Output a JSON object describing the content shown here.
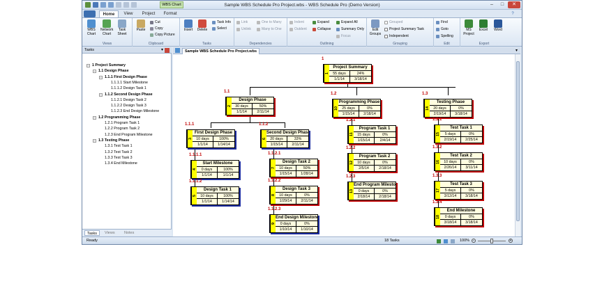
{
  "window": {
    "title": "Sample WBS Schedule Pro Project.wbs - WBS Schedule Pro (Demo Version)",
    "context_tab": "WBS Chart"
  },
  "tabs": [
    "Home",
    "View",
    "Project",
    "Format"
  ],
  "ribbon": {
    "views": {
      "label": "Views",
      "wbs_chart": "WBS\nChart",
      "network_chart": "Network\nChart",
      "task_sheet": "Task\nSheet"
    },
    "clipboard": {
      "label": "Clipboard",
      "paste": "Paste",
      "cut": "Cut",
      "copy": "Copy",
      "copy_picture": "Copy Picture"
    },
    "tasks": {
      "label": "Tasks",
      "insert": "Insert",
      "delete": "Delete",
      "task_info": "Task Info",
      "select": "Select"
    },
    "dependencies": {
      "label": "Dependencies",
      "link": "Link",
      "unlink": "Unlink",
      "one_to_many": "One to Many",
      "many_to_one": "Many to One"
    },
    "outlining": {
      "label": "Outlining",
      "indent": "Indent",
      "outdent": "Outdent",
      "expand": "Expand",
      "collapse": "Collapse",
      "expand_all": "Expand All",
      "summary_only": "Summary Only",
      "focus": "Focus"
    },
    "grouping": {
      "label": "Grouping",
      "edit_groups": "Edit\nGroups",
      "grouped": "Grouped",
      "project_summary_task": "Project Summary Task",
      "independent": "Independent"
    },
    "edit": {
      "label": "Edit",
      "find": "Find",
      "goto": "Goto",
      "spelling": "Spelling"
    },
    "export": {
      "label": "Export",
      "ms_project": "MS\nProject",
      "excel": "Excel",
      "word": "Word"
    }
  },
  "tasks_pane": {
    "title": "Tasks",
    "tree": [
      {
        "label": "1 Project Summary",
        "bold": true,
        "indent": 0
      },
      {
        "label": "1.1 Design Phase",
        "bold": true,
        "indent": 1
      },
      {
        "label": "1.1.1 First Design Phase",
        "bold": true,
        "indent": 2
      },
      {
        "label": "1.1.1.1 Start Milestone",
        "bold": false,
        "indent": 3
      },
      {
        "label": "1.1.1.2 Design Task 1",
        "bold": false,
        "indent": 3
      },
      {
        "label": "1.1.2 Second Design Phase",
        "bold": true,
        "indent": 2
      },
      {
        "label": "1.1.2.1 Design Task 2",
        "bold": false,
        "indent": 3
      },
      {
        "label": "1.1.2.2 Design Task 3",
        "bold": false,
        "indent": 3
      },
      {
        "label": "1.1.2.3 End Design Milestone",
        "bold": false,
        "indent": 3
      },
      {
        "label": "1.2 Programming Phase",
        "bold": true,
        "indent": 1
      },
      {
        "label": "1.2.1 Program Task 1",
        "bold": false,
        "indent": 2
      },
      {
        "label": "1.2.2 Program Task 2",
        "bold": false,
        "indent": 2
      },
      {
        "label": "1.2.3 End Program Milestone",
        "bold": false,
        "indent": 2
      },
      {
        "label": "1.3 Testing Phase",
        "bold": true,
        "indent": 1
      },
      {
        "label": "1.3.1 Test Task 1",
        "bold": false,
        "indent": 2
      },
      {
        "label": "1.3.2 Test Task 2",
        "bold": false,
        "indent": 2
      },
      {
        "label": "1.3.3 Test Task 3",
        "bold": false,
        "indent": 2
      },
      {
        "label": "1.3.4 End Milestone",
        "bold": false,
        "indent": 2
      }
    ],
    "bottom_tabs": [
      "Tasks",
      "Views",
      "Notes"
    ]
  },
  "document_tab": "Sample WBS Schedule Pro Project.wbs",
  "chart": {
    "nodes": [
      {
        "wbs": "1",
        "id": "1",
        "name": "Project Summary",
        "duration": "55 days",
        "pct": "24%",
        "start": "1/1/14",
        "finish": "3/18/14",
        "color": "red"
      },
      {
        "wbs": "1.1",
        "id": "2",
        "name": "Design Phase",
        "duration": "30 days",
        "pct": "50%",
        "start": "1/1/14",
        "finish": "2/11/14",
        "color": "red"
      },
      {
        "wbs": "1.2",
        "id": "10",
        "name": "Programming Phase",
        "duration": "25 days",
        "pct": "0%",
        "start": "1/15/14",
        "finish": "2/18/14",
        "color": "red"
      },
      {
        "wbs": "1.3",
        "id": "14",
        "name": "Testing Phase",
        "duration": "20 days",
        "pct": "0%",
        "start": "2/19/14",
        "finish": "3/18/14",
        "color": "red"
      },
      {
        "wbs": "1.1.1",
        "id": "3",
        "name": "First Design Phase",
        "duration": "10 days",
        "pct": "100%",
        "start": "1/1/14",
        "finish": "1/14/14",
        "color": "blue"
      },
      {
        "wbs": "1.1.2",
        "id": "6",
        "name": "Second Design Phase",
        "duration": "20 days",
        "pct": "33%",
        "start": "1/15/14",
        "finish": "2/11/14",
        "color": "blue"
      },
      {
        "wbs": "1.1.1.1",
        "id": "4",
        "name": "Start Milestone",
        "duration": "0 days",
        "pct": "100%",
        "start": "1/1/14",
        "finish": "1/1/14",
        "color": "blue"
      },
      {
        "wbs": "1.1.1.2",
        "id": "5",
        "name": "Design Task 1",
        "duration": "10 days",
        "pct": "100%",
        "start": "1/1/14",
        "finish": "1/14/14",
        "color": "blue"
      },
      {
        "wbs": "1.1.2.1",
        "id": "7",
        "name": "Design Task 2",
        "duration": "10 days",
        "pct": "50%",
        "start": "1/15/14",
        "finish": "1/28/14",
        "color": "red"
      },
      {
        "wbs": "1.1.2.2",
        "id": "8",
        "name": "Design Task 3",
        "duration": "10 days",
        "pct": "0%",
        "start": "1/29/14",
        "finish": "2/11/14",
        "color": "red"
      },
      {
        "wbs": "1.1.2.3",
        "id": "9",
        "name": "End Design Milestone",
        "duration": "0 days",
        "pct": "0%",
        "start": "1/10/14",
        "finish": "1/10/14",
        "color": "blue"
      },
      {
        "wbs": "1.2.1",
        "id": "11",
        "name": "Program Task 1",
        "duration": "15 days",
        "pct": "0%",
        "start": "1/15/14",
        "finish": "2/4/14",
        "color": "red"
      },
      {
        "wbs": "1.2.2",
        "id": "12",
        "name": "Program Task 2",
        "duration": "10 days",
        "pct": "0%",
        "start": "2/5/14",
        "finish": "2/18/14",
        "color": "red"
      },
      {
        "wbs": "1.2.3",
        "id": "13",
        "name": "End Program Milestone",
        "duration": "0 days",
        "pct": "0%",
        "start": "2/18/14",
        "finish": "2/18/14",
        "color": "red"
      },
      {
        "wbs": "1.3.1",
        "id": "15",
        "name": "Test Task 1",
        "duration": "5 days",
        "pct": "0%",
        "start": "2/19/14",
        "finish": "2/25/14",
        "color": "red"
      },
      {
        "wbs": "1.3.2",
        "id": "16",
        "name": "Test Task 2",
        "duration": "10 days",
        "pct": "0%",
        "start": "2/26/14",
        "finish": "3/11/14",
        "color": "red"
      },
      {
        "wbs": "1.3.3",
        "id": "17",
        "name": "Test Task 3",
        "duration": "5 days",
        "pct": "0%",
        "start": "3/12/14",
        "finish": "3/18/14",
        "color": "red"
      },
      {
        "wbs": "1.3.4",
        "id": "18",
        "name": "End Milestone",
        "duration": "0 days",
        "pct": "0%",
        "start": "3/18/14",
        "finish": "3/18/14",
        "color": "red"
      }
    ]
  },
  "status": {
    "left": "Ready",
    "center": "18 Tasks",
    "zoom": "100%"
  }
}
